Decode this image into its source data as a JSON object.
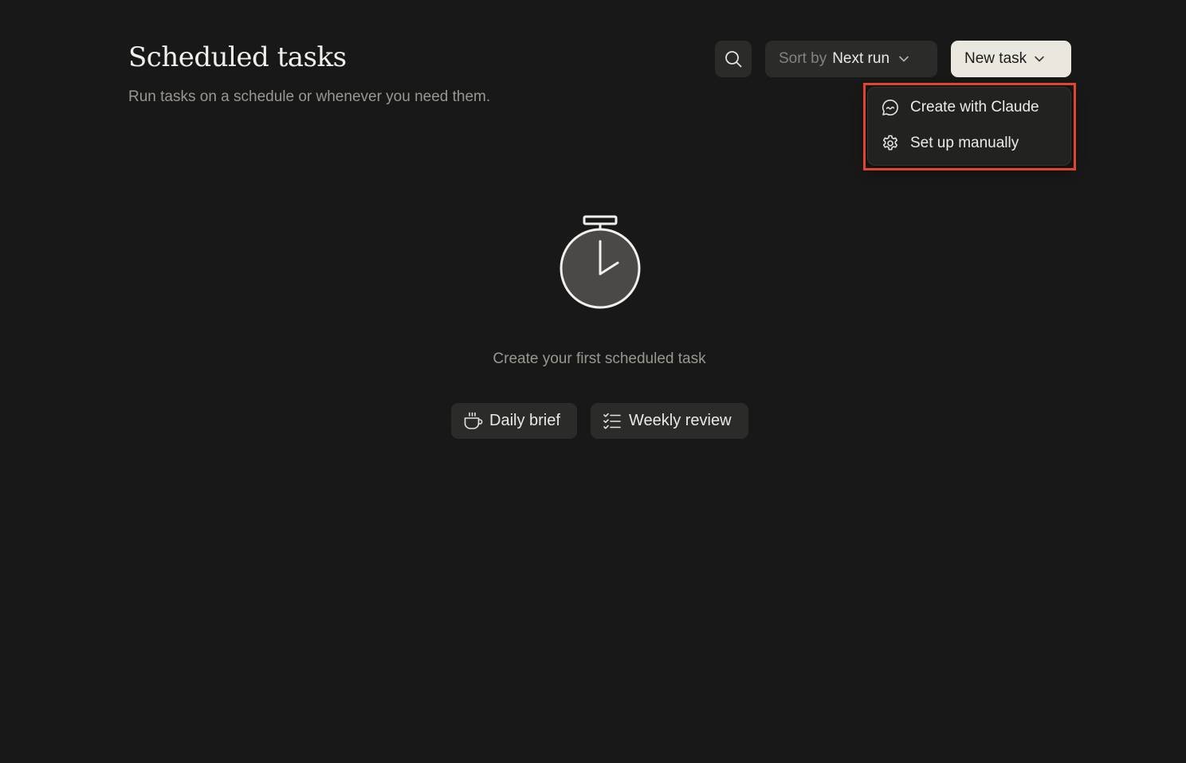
{
  "header": {
    "title": "Scheduled tasks",
    "subtitle": "Run tasks on a schedule or whenever you need them."
  },
  "toolbar": {
    "search_icon": "search-icon",
    "sort_label": "Sort by",
    "sort_value": "Next run",
    "new_task_label": "New task"
  },
  "new_task_menu": {
    "items": [
      {
        "label": "Create with Claude",
        "icon": "chat-bubble-icon"
      },
      {
        "label": "Set up manually",
        "icon": "gear-icon"
      }
    ],
    "highlight_color": "#e0452e"
  },
  "empty_state": {
    "illustration": "stopwatch-icon",
    "message": "Create your first scheduled task",
    "suggestions": [
      {
        "label": "Daily brief",
        "icon": "coffee-cup-icon"
      },
      {
        "label": "Weekly review",
        "icon": "checklist-icon"
      }
    ]
  },
  "colors": {
    "background": "#181818",
    "surface": "#2b2b2a",
    "primary_button": "#eae7df"
  }
}
